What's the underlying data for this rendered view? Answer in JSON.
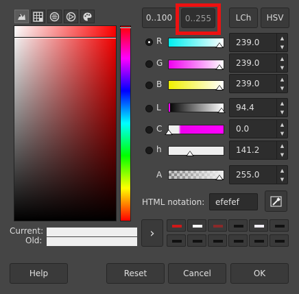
{
  "selector_tabs": [
    {
      "icon": "gimp-selector-icon",
      "active": true
    },
    {
      "icon": "cmyk-grid-icon",
      "active": false
    },
    {
      "icon": "watercolor-icon",
      "active": false
    },
    {
      "icon": "wheel-triangle-icon",
      "active": false
    },
    {
      "icon": "palette-icon",
      "active": false
    }
  ],
  "range_buttons": {
    "r0_100": "0..100",
    "r0_255": "0..255"
  },
  "mode_buttons": {
    "lch": "LCh",
    "hsv": "HSV"
  },
  "channels": {
    "r": {
      "label": "R",
      "value": "239.0",
      "selected": true
    },
    "g": {
      "label": "G",
      "value": "239.0",
      "selected": false
    },
    "b": {
      "label": "B",
      "value": "239.0",
      "selected": false
    },
    "l": {
      "label": "L",
      "value": "94.4",
      "selected": false
    },
    "c": {
      "label": "C",
      "value": "0.0",
      "selected": false
    },
    "h": {
      "label": "h",
      "value": "141.2",
      "selected": false
    },
    "a": {
      "label": "A",
      "value": "255.0"
    }
  },
  "html_notation": {
    "label": "HTML notation:",
    "value": "efefef"
  },
  "swatches": {
    "current_label": "Current:",
    "old_label": "Old:",
    "current_color": "#efefef",
    "old_color": "#efefef"
  },
  "history_colors": [
    "#d01818",
    "#ffffff",
    "#8a2a2a",
    "#111111",
    "#f4f0f8",
    "#111111",
    "#111111",
    "#111111",
    "#111111",
    "#111111",
    "#111111",
    "#111111"
  ],
  "footer": {
    "help": "Help",
    "reset": "Reset",
    "cancel": "Cancel",
    "ok": "OK"
  }
}
